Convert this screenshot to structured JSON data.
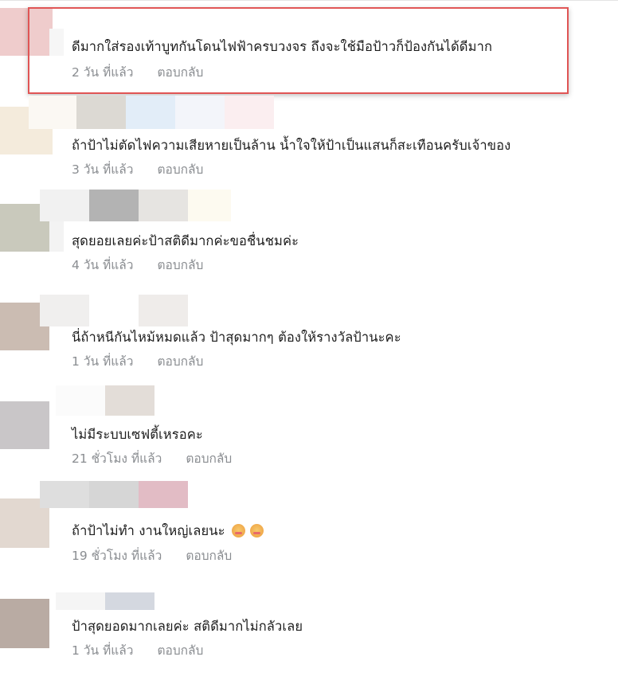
{
  "comments": [
    {
      "text": "ดีมากใส่รองเท้าบูทกันโดนไฟฟ้าครบวงจร ถึงจะใช้มือป้าวก็ป้องกันได้ดีมาก",
      "time": "2 วัน ที่แล้ว",
      "reply": "ตอบกลับ",
      "highlighted": true
    },
    {
      "text": "ถ้าป้าไม่ตัดไฟความเสียหายเป็นล้าน น้ำใจให้ป้าเป็นแสนก็สะเทือนครับเจ้าของ",
      "time": "3 วัน ที่แล้ว",
      "reply": "ตอบกลับ"
    },
    {
      "text": "สุดยอยเลยค่ะป้าสติดีมากค่ะขอชื่นชมค่ะ",
      "time": "4 วัน ที่แล้ว",
      "reply": "ตอบกลับ"
    },
    {
      "text": "นี่ถ้าหนีกันไหม้หมดแล้ว ป้าสุดมากๆ ต้องให้รางวัลป้านะคะ",
      "time": "1 วัน ที่แล้ว",
      "reply": "ตอบกลับ"
    },
    {
      "text": "ไม่มีระบบเซฟตี้เหรอคะ",
      "time": "21 ชั่วโมง ที่แล้ว",
      "reply": "ตอบกลับ"
    },
    {
      "text": "ถ้าป้าไม่ทำ งานใหญ่เลยนะ",
      "time": "19 ชั่วโมง ที่แล้ว",
      "reply": "ตอบกลับ",
      "emojis": [
        "worried-face-emoji",
        "worried-face-emoji"
      ]
    },
    {
      "text": "ป้าสุดยอดมากเลยค่ะ สติดีมากไม่กลัวเลย",
      "time": "1 วัน ที่แล้ว",
      "reply": "ตอบกลับ"
    }
  ],
  "highlight_color": "#e05555",
  "text_color": "#1c1c1c",
  "meta_color": "#8a8d91"
}
